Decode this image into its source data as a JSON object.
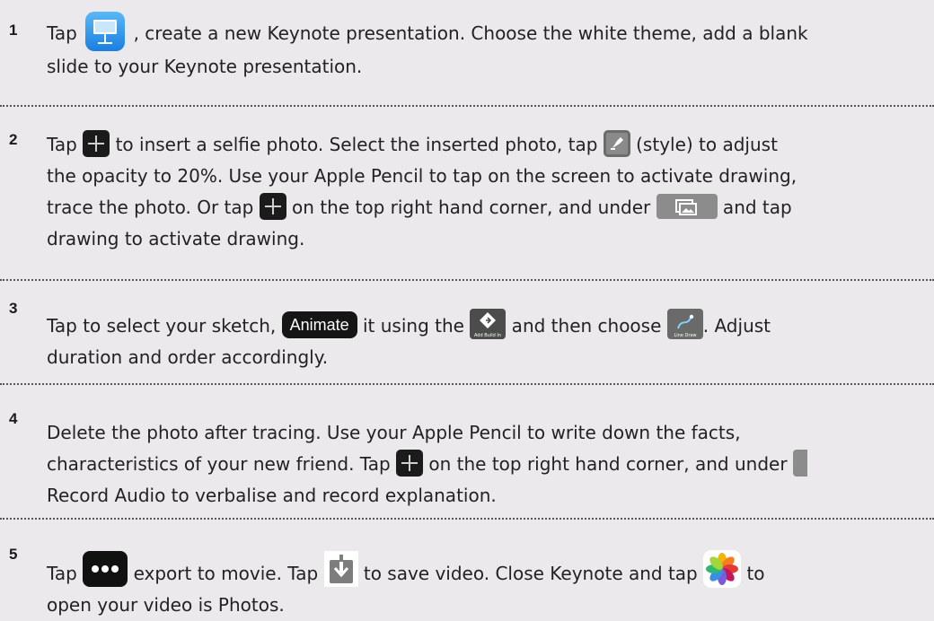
{
  "steps": [
    {
      "number": "1",
      "parts": {
        "a": "Tap ",
        "b": " , create a new Keynote presentation. Choose the white theme, add a blank",
        "c": "slide to your Keynote presentation."
      }
    },
    {
      "number": "2",
      "parts": {
        "a": "Tap ",
        "b": " to insert a selfie photo. Select the inserted photo, tap ",
        "c": " (style) to adjust",
        "d": "the opacity to 20%. Use your Apple Pencil to tap on the screen to activate drawing,",
        "e": "trace the photo. Or tap ",
        "f": " on the top right hand corner, and under ",
        "g": " and tap",
        "h": "drawing to activate drawing."
      }
    },
    {
      "number": "3",
      "parts": {
        "a": "Tap to select your sketch, ",
        "animate": "Animate",
        "b": " it using the ",
        "c": " and then choose ",
        "d": ". Adjust",
        "e": "duration and order accordingly."
      },
      "icon_captions": {
        "build": "Add Build In",
        "line": "Line Draw"
      }
    },
    {
      "number": "4",
      "parts": {
        "a": "Delete the photo after tracing. Use your Apple Pencil to write down the facts,",
        "b": "characteristics of your new friend. Tap ",
        "c": " on the top right hand corner, and under ",
        "d": "Record Audio to verbalise and record explanation."
      }
    },
    {
      "number": "5",
      "parts": {
        "a": "Tap ",
        "b": " export to movie. Tap ",
        "c": " to save video. Close Keynote and tap ",
        "d": " to",
        "e": "open your video is Photos."
      }
    }
  ],
  "icons": {
    "keynote": "keynote-app-icon",
    "plus": "plus-icon",
    "style": "paintbrush-style-icon",
    "media": "media-icon",
    "build": "add-build-in-icon",
    "line": "line-draw-icon",
    "dots": "more-dots-icon",
    "save": "save-download-icon",
    "photos": "photos-app-icon"
  },
  "colors": {
    "background": "#ece9ec",
    "text": "#222222",
    "keynote_blue": "#1a7fe0",
    "icon_dark": "#1b1b1b"
  }
}
